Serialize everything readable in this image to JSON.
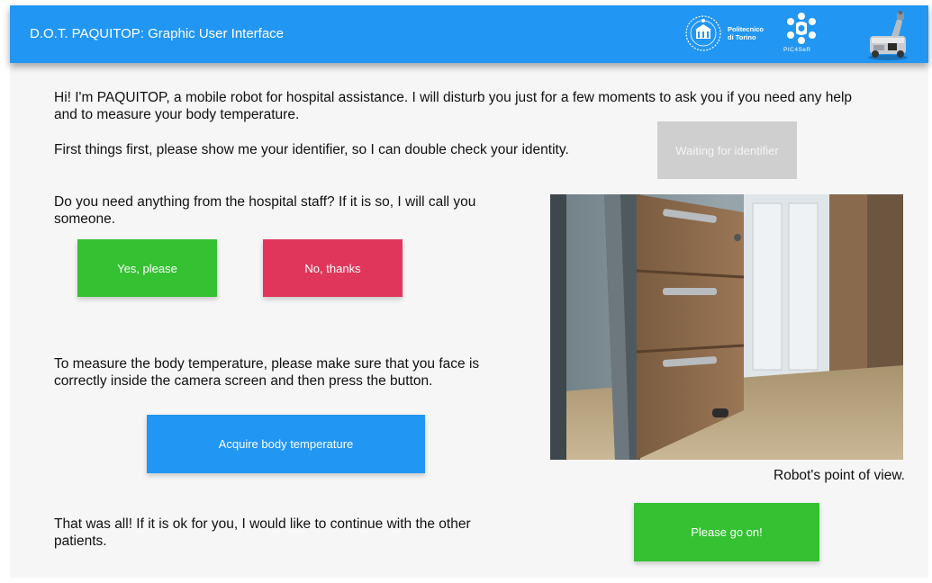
{
  "header": {
    "title": "D.O.T. PAQUITOP: Graphic User Interface",
    "polito_line1": "Politecnico",
    "polito_line2": "di Torino",
    "pic_label": "PIC4SeR"
  },
  "intro": {
    "text": "Hi! I'm PAQUITOP, a mobile robot for hospital assistance. I will disturb you just for a few moments to ask you if you need any help and to measure your body temperature."
  },
  "identifier": {
    "prompt": "First things first, please show me your identifier, so I can double check your identity.",
    "status_button": "Waiting for identifier"
  },
  "staff": {
    "prompt": "Do you need anything from the hospital staff? If it is so, I will call you someone.",
    "yes_button": "Yes, please",
    "no_button": "No, thanks"
  },
  "temperature": {
    "prompt": "To measure the body temperature, please make sure that you face is correctly inside the camera screen and then press the button.",
    "button": "Acquire body temperature"
  },
  "camera": {
    "caption": "Robot's point of view."
  },
  "finish": {
    "prompt": "That was all! If it is ok for you, I would like to continue with the other patients.",
    "button": "Please go on!"
  },
  "colors": {
    "header_blue": "#2196f3",
    "green": "#34c132",
    "red": "#e0365b",
    "disabled_grey": "#cfcfcf"
  },
  "icons": [
    "politecnico-seal-logo",
    "pic4ser-logo",
    "paquitop-robot-image"
  ]
}
